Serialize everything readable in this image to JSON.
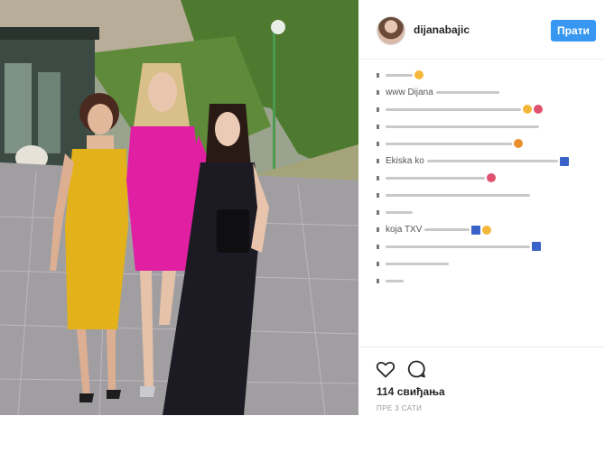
{
  "post": {
    "photo_alt": "",
    "username": "dijanabajic",
    "follow_label": "Прати",
    "likes": "114 свиђања",
    "timestamp": "ПРЕ 3 САТИ"
  },
  "comments": [
    {
      "frag": "",
      "bar": 30
    },
    {
      "frag": "www Dijana",
      "bar": 120
    },
    {
      "frag": "",
      "bar": 150
    },
    {
      "frag": "",
      "bar": 170
    },
    {
      "frag": "",
      "bar": 140
    },
    {
      "frag": "Ekiska ko",
      "bar": 190
    },
    {
      "frag": "",
      "bar": 110
    },
    {
      "frag": "",
      "bar": 160
    },
    {
      "frag": "",
      "bar": 30
    },
    {
      "frag": "koja TXV",
      "bar": 90
    },
    {
      "frag": "",
      "bar": 160
    },
    {
      "frag": "",
      "bar": 70
    },
    {
      "frag": "",
      "bar": 20
    }
  ],
  "colors": {
    "follow": "#3897f0",
    "text": "#262626",
    "muted": "#999999"
  },
  "icons": {
    "like": "heart-icon",
    "comment": "comment-bubble-icon"
  }
}
